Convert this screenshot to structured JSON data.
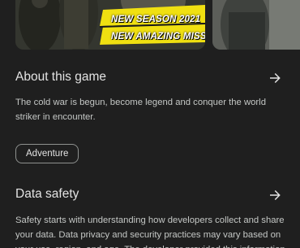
{
  "screenshots": {
    "promo_line_1": "NEW SEASON 2021",
    "promo_line_2": "NEW AMAZING MISSIONS",
    "accent_color": "#f0e011"
  },
  "about": {
    "title": "About this game",
    "description": "The cold war is begun, become legend and conquer the world striker in encounter.",
    "arrow_icon": "arrow-right-icon"
  },
  "tags": {
    "items": [
      "Adventure"
    ]
  },
  "data_safety": {
    "title": "Data safety",
    "description": "Safety starts with understanding how developers collect and share your data. Data privacy and security practices may vary based on your use, region, and age. The developer provided this information",
    "arrow_icon": "arrow-right-icon"
  }
}
